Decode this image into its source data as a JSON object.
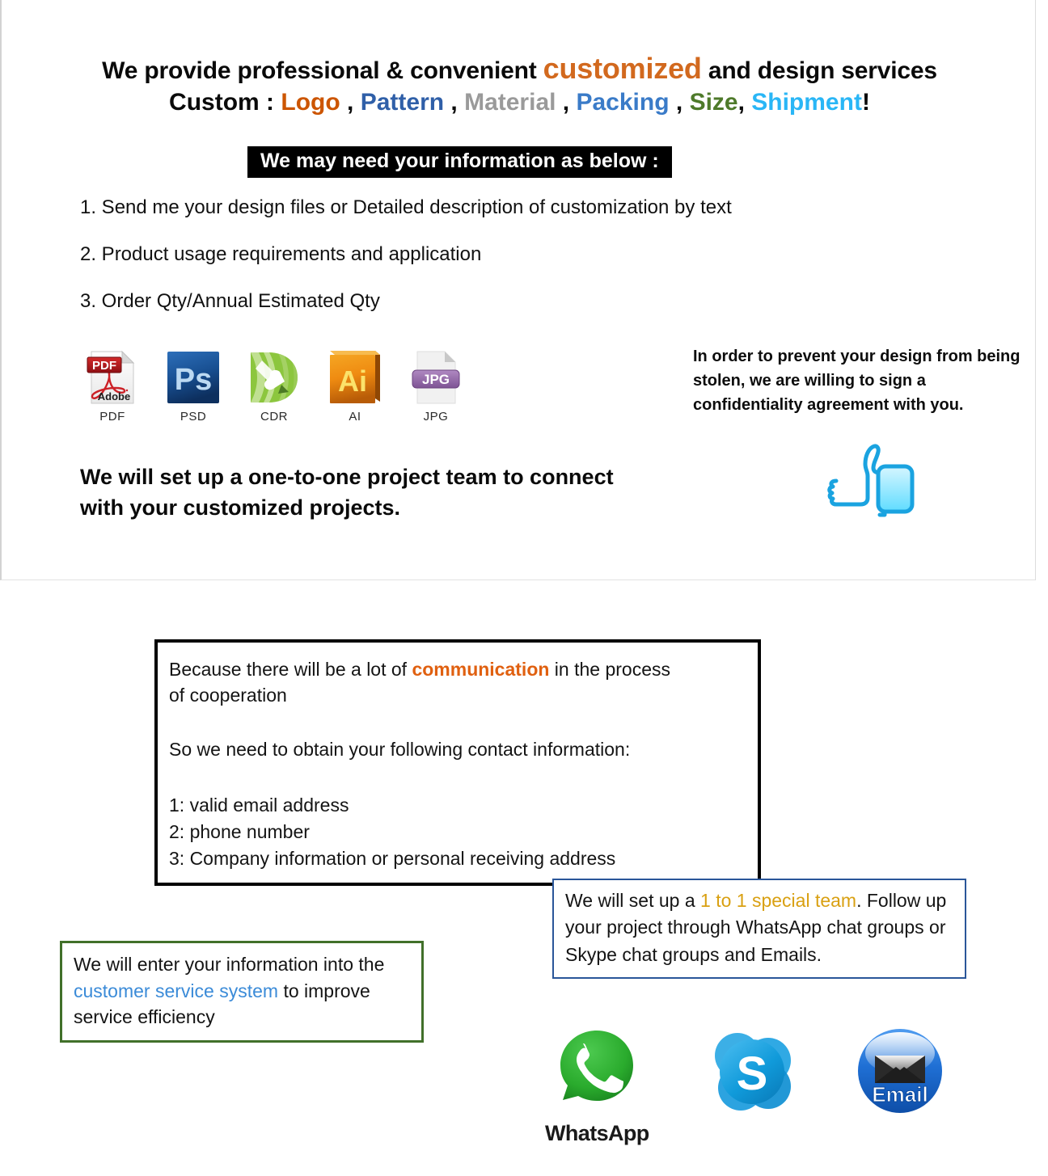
{
  "headline": {
    "line1_prefix": "We provide professional & convenient ",
    "line1_highlight": "customized",
    "line1_suffix": " and design services",
    "line2_label": "Custom : ",
    "line2_items": [
      {
        "word": "Logo",
        "color": "#cc5500",
        "sep": " , "
      },
      {
        "word": "Pattern",
        "color": "#2f5fa8",
        "sep": " , "
      },
      {
        "word": "Material",
        "color": "#9a9a9a",
        "sep": " , "
      },
      {
        "word": "Packing",
        "color": "#3a7bc8",
        "sep": " , "
      },
      {
        "word": "Size",
        "color": "#4e7a2a",
        "sep": ",  "
      },
      {
        "word": "Shipment",
        "color": "#29b6f6",
        "sep": "!"
      }
    ],
    "line2_logo": "Logo",
    "line2_sep1": " , ",
    "line2_pattern": "Pattern",
    "line2_sep2": " , ",
    "line2_material": "Material",
    "line2_sep3": " , ",
    "line2_packing": "Packing",
    "line2_sep4": " , ",
    "line2_size": "Size",
    "line2_sep5": ",  ",
    "line2_shipment": "Shipment",
    "line2_bang": "!"
  },
  "banner": {
    "text": "We may need your information as below :",
    "background": "#000000",
    "color": "#ffffff"
  },
  "requirements": [
    "1. Send me your design files or Detailed description of customization by text",
    "2. Product usage requirements and application",
    "3. Order Qty/Annual Estimated Qty"
  ],
  "file_formats": [
    {
      "label": "PDF",
      "icon": "pdf-file-icon",
      "badge": "PDF",
      "sub": "Adobe",
      "color": "#b81c22"
    },
    {
      "label": "PSD",
      "icon": "photoshop-icon",
      "badge": "Ps",
      "color": "#1c4e8a"
    },
    {
      "label": "CDR",
      "icon": "coreldraw-icon",
      "badge": "",
      "color": "#8cc63e"
    },
    {
      "label": "AI",
      "icon": "illustrator-icon",
      "badge": "Ai",
      "color": "#e8860c"
    },
    {
      "label": "JPG",
      "icon": "jpg-file-icon",
      "badge": "JPG",
      "color": "#9b6fae"
    }
  ],
  "confidentiality": {
    "text": "In order to prevent your design from being stolen, we are willing to sign a confidentiality agreement with you."
  },
  "project_team": {
    "text": "We will set up a one-to-one project team to connect with your customized projects."
  },
  "thumbs_up": {
    "icon": "thumbs-up-icon",
    "color": "#1aa3e0"
  },
  "communication_box": {
    "line1_prefix": "Because there will be a lot of ",
    "line1_highlight": "communication",
    "line1_suffix": " in the process",
    "line2": "of cooperation",
    "line3": "So we need to obtain your following contact information:",
    "contacts": [
      "1: valid email address",
      "2: phone number",
      "3: Company information or personal receiving address"
    ],
    "border_color": "#000000",
    "highlight_color": "#e06010"
  },
  "special_team_box": {
    "prefix": "We will set up a ",
    "highlight": "1 to 1 special team",
    "suffix": ". Follow up your project through WhatsApp chat groups or Skype chat groups and Emails.",
    "border_color": "#2a5699",
    "highlight_color": "#d9a012"
  },
  "customer_service_box": {
    "prefix": "We will enter your information into the ",
    "highlight": "customer service system",
    "suffix": " to improve service efficiency",
    "border_color": "#41702a",
    "highlight_color": "#3b8bd8"
  },
  "contact_channels": [
    {
      "name": "WhatsApp",
      "wordmark": "WhatsApp",
      "icon": "whatsapp-icon",
      "color": "#2eb43a"
    },
    {
      "name": "Skype",
      "wordmark": "",
      "icon": "skype-icon",
      "color": "#139bdc"
    },
    {
      "name": "Email",
      "wordmark": "",
      "label_in_icon": "Email",
      "icon": "email-icon",
      "color": "#1a6fd4"
    }
  ]
}
